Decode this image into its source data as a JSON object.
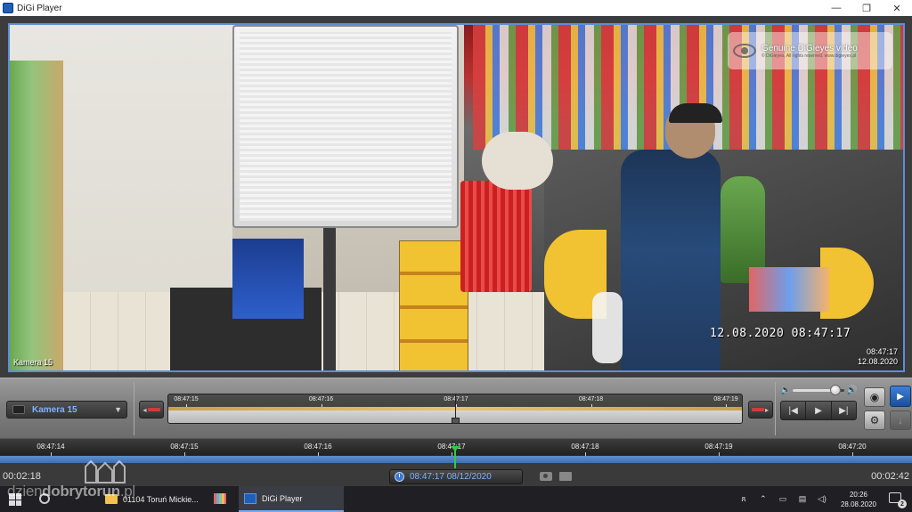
{
  "window": {
    "title": "DiGi Player",
    "controls": {
      "minimize": "—",
      "maximize": "❐",
      "close": "✕"
    }
  },
  "video": {
    "watermark_title": "Genuine DiGieyes video",
    "watermark_sub": "© DiGieyes, All rights reserved. www.digieyes.pl",
    "osd_timestamp": "12.08.2020 08:47:17",
    "camera_label": "Kamera 15",
    "corner_time": "08:47:17",
    "corner_date": "12.08.2020"
  },
  "controls": {
    "camera_select": "Kamera 15",
    "mini_timeline_ticks": [
      "08:47:15",
      "08:47:16",
      "08:47:17",
      "08:47:18",
      "08:47:19"
    ],
    "volume_level": 0.82,
    "playback_buttons": [
      "skip-back-icon",
      "play-icon",
      "skip-forward-icon"
    ]
  },
  "timeline": {
    "ticks": [
      "08:47:14",
      "08:47:15",
      "08:47:16",
      "08:47:17",
      "08:47:18",
      "08:47:19",
      "08:47:20"
    ],
    "elapsed": "00:02:18",
    "total": "00:02:42",
    "current_datetime": "08:47:17 08/12/2020"
  },
  "taskbar": {
    "tasks": [
      {
        "label": "01104 Toruń Mickie...",
        "icon": "folder-icon"
      },
      {
        "label": "DiGi Player",
        "icon": "digi-player-icon"
      }
    ],
    "clock_time": "20:26",
    "clock_date": "28.08.2020",
    "notification_count": "2"
  },
  "site_watermark": {
    "text_pre": "dzien",
    "text_main": "dobrytorun",
    "text_post": ".pl"
  },
  "colors": {
    "accent": "#5b8fd8",
    "timeline_bar": "#4a7cc2",
    "playhead": "#2ecc40",
    "datetime_text": "#7fb3ff"
  }
}
